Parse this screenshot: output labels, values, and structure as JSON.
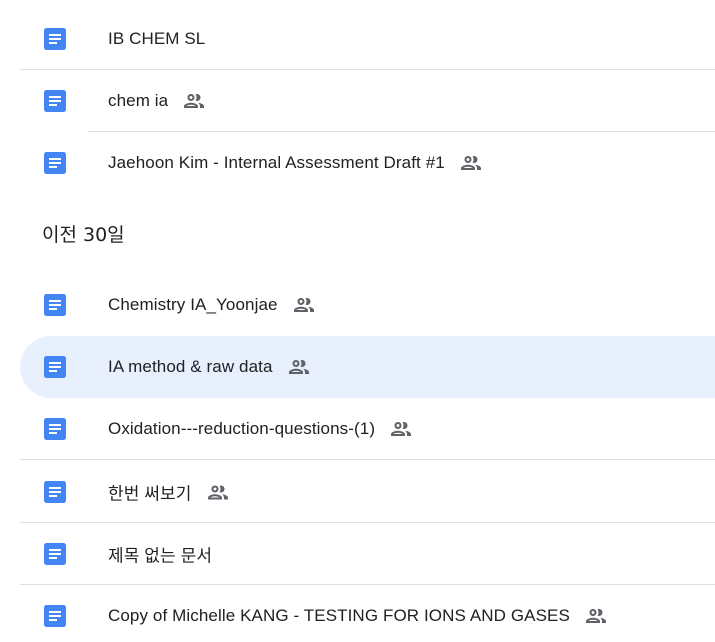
{
  "section_header": "이전 30일",
  "documents_top": [
    {
      "title": "IB CHEM SL",
      "shared": false
    },
    {
      "title": "chem ia",
      "shared": true
    },
    {
      "title": "Jaehoon Kim - Internal Assessment Draft #1",
      "shared": true
    }
  ],
  "documents_bottom": [
    {
      "title": "Chemistry IA_Yoonjae",
      "shared": true
    },
    {
      "title": "IA method & raw data",
      "shared": true,
      "selected": true
    },
    {
      "title": "Oxidation---reduction-questions-(1)",
      "shared": true
    },
    {
      "title": "한번 써보기",
      "shared": true
    },
    {
      "title": "제목 없는 문서",
      "shared": false
    },
    {
      "title": "Copy of Michelle KANG - TESTING FOR IONS AND GASES",
      "shared": true
    }
  ],
  "icons": {
    "document": "google-docs-icon",
    "shared": "shared-people-icon"
  },
  "colors": {
    "doc_icon": "#4285f4",
    "selected_bg": "#e8f0fe",
    "divider": "#e0e0e0",
    "shared_icon": "#5f6368"
  }
}
